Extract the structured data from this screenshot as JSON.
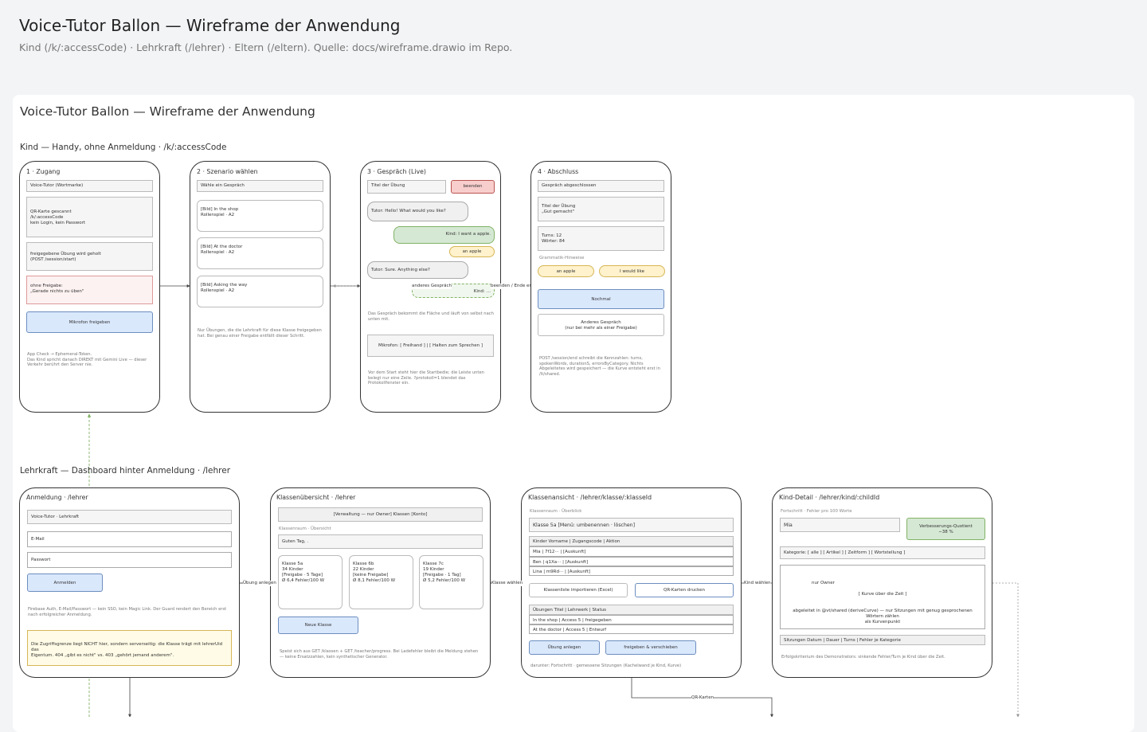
{
  "header": {
    "title": "Voice-Tutor Ballon — Wireframe der Anwendung",
    "subtitle": "Kind (/k/:accessCode) · Lehrkraft (/lehrer) · Eltern (/eltern). Quelle: docs/wireframe.drawio im Repo."
  },
  "diagram": {
    "title": "Voice-Tutor Ballon — Wireframe der Anwendung",
    "kind_lane": "Kind — Handy, ohne Anmeldung · /k/:accessCode",
    "lehrer_lane": "Lehrkraft — Dashboard hinter Anmeldung · /lehrer"
  },
  "s1": {
    "title": "1 · Zugang",
    "wordmark": "Voice-Tutor (Wortmarke)",
    "qr": "QR-Karte gescannt\n/k/:accessCode\nkein Login, kein Passwort",
    "session": "freigegebene Übung wird geholt\n(POST /session/start)",
    "nofree": "ohne Freigabe:\n„Gerade nichts zu üben\"",
    "mic": "Mikrofon freigeben",
    "note": "App Check → Ephemeral-Token.\nDas Kind spricht danach DIREKT mit Gemini Live — dieser\nVerkehr berührt den Server nie."
  },
  "s2": {
    "title": "2 · Szenario wählen",
    "heading": "Wähle ein Gespräch",
    "opt1": "[Bild] In the shop\nRollenspiel · A2",
    "opt2": "[Bild] At the doctor\nRollenspiel · A2",
    "opt3": "[Bild] Asking the way\nRollenspiel · A2",
    "note": "Nur Übungen, die die Lehrkraft für diese Klasse freigegeben\nhat. Bei genau einer Freigabe entfällt dieser Schritt."
  },
  "s3": {
    "title": "3 · Gespräch (Live)",
    "exercise_title": "Titel der Übung",
    "end": "beenden",
    "tutor1": "Tutor: Hello! What would you like?",
    "kid1": "Kind: I want a apple.",
    "correction": "an apple",
    "tutor2": "Tutor: Sure. Anything else?",
    "kid2": "Kind: …",
    "note1": "Das Gespräch bekommt die Fläche und läuft von selbst nach\nunten mit.",
    "mic": "Mikrofon: [ Freihand ] | [ Halten zum Sprechen ]",
    "note2": "Vor dem Start steht hier die Startbedie; die Leiste unten\nbelegt nur eine Zeile. ?protokoll=1 blendet das\nProtokollfenster ein."
  },
  "s4": {
    "title": "4 · Abschluss",
    "done": "Gespräch abgeschlossen",
    "praise": "Titel der Übung\n„Gut gemacht\"",
    "stats": "Turns: 12\nWörter: 84",
    "grammar_label": "Grammatik-Hinweise",
    "chip1": "an apple",
    "chip2": "I would like",
    "again": "Nochmal",
    "other": "Anderes Gespräch\n(nur bei mehr als einer Freigabe)",
    "note": "POST /session/end schreibt die Kennzahlen: turns,\nspokenWords, durationS, errorsByCategory. Nichts\nAbgeleitetes wird gespeichert — die Kurve entsteht erst in\n/lt/shared."
  },
  "edges": {
    "other_talk": "anderes Gespräch",
    "end_reached": "beenden / Ende erreicht",
    "create_exercise": "Übung anlegen",
    "choose_class": "Klasse wählen",
    "choose_kid": "Kind wählen",
    "qr_cards": "QR-Karten"
  },
  "l1": {
    "title": "Anmeldung · /lehrer",
    "brand": "Voice-Tutor · Lehrkraft",
    "email": "E-Mail",
    "password": "Passwort",
    "login": "Anmelden",
    "note": "Firebase Auth, E-Mail/Passwort — kein SSO, kein Magic Link. Der Guard rendert den Bereich erst\nnach erfolgreicher Anmeldung.",
    "warn": "Die Zugriffsgrenze liegt NICHT hier, sondern serverseitig: die Klasse trägt mit lehrerUid das\nEigentum. 404 „gibt es nicht\" vs. 403 „gehört jemand anderem\"."
  },
  "l2": {
    "title": "Klassenübersicht · /lehrer",
    "nav": "[Verwaltung — nur Owner] Klassen [Konto]",
    "overview_label": "Klassenraum · Übersicht",
    "greeting": "Guten Tag, .",
    "c1": "Klasse 5a\n34 Kinder\n[Freigabe · 5 Tage]\nØ 6,4 Fehler/100 W",
    "c2": "Klasse 6b\n22 Kinder\n[keine Freigabe]\nØ 8,1 Fehler/100 W",
    "c3": "Klasse 7c\n19 Kinder\n[Freigabe · 1 Tag]\nØ 5,2 Fehler/100 W",
    "new_class": "Neue Klasse",
    "note": "Speist sich aus GET /klassen + GET /teacher/progress. Bei Ladefehler bleibt die Meldung stehen\n— keine Ersatzzahlen, kein synthetischer Generator."
  },
  "l3": {
    "title": "Klassenansicht · /lehrer/klasse/:klasseId",
    "overview_label": "Klassenraum · Überblick",
    "class_header": "Klasse 5a [Menü: umbenennen · löschen]",
    "kids_header": "Kinder Vorname | Zugangscode | Aktion",
    "kid1": "Mia | 7f12··· | [Auskunft]",
    "kid2": "Ben | q1Xa··· | [Auskunft]",
    "kid3": "Lina | m9Rd··· | [Auskunft]",
    "import": "Klassenliste importieren (Excel)",
    "qr_print": "QR-Karten drucken",
    "ex_header": "Übungen Titel | Lehrwerk | Status",
    "ex1": "In the shop | Access 5 | freigegeben",
    "ex2": "At the doctor | Access 5 | Entwurf",
    "create": "Übung anlegen",
    "release": "freigeben & verschieben",
    "note": "darunter: Fortschritt · gemessene Sitzungen (Kachelwand je Kind, Kurve)"
  },
  "l4": {
    "title": "Kind-Detail · /lehrer/kind/:childId",
    "progress_label": "Fortschritt · Fehler pro 100 Worte",
    "name": "Mia",
    "quotient": "Verbesserungs-Quotient\n−38 %",
    "categories": "Kategorie: [ alle ] [ Artikel ] [ Zeitform ] [ Wortstellung ]",
    "owner": "nur Owner",
    "curve": "[ Kurve über die Zeit ]",
    "curve_note": "abgeleitet in @vt/shared (deriveCurve) — nur Sitzungen mit genug gesprochenen Wörtern zählen\nals Kurvenpunkt",
    "sessions": "Sitzungen Datum | Dauer | Turns | Fehler je Kategorie",
    "note": "Erfolgskriterium des Demonstrators: sinkende Fehler/Turn je Kind über die Zeit."
  }
}
